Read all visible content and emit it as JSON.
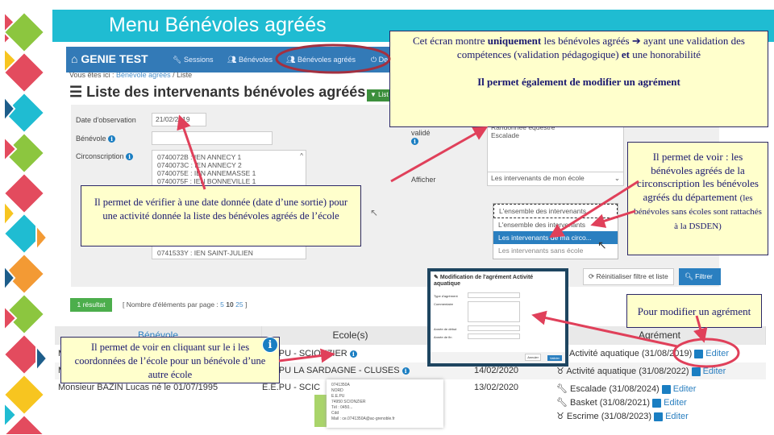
{
  "slide": {
    "title": "Menu Bénévoles agréés",
    "accent": "#1fbcd2"
  },
  "app": {
    "brand": "GENIE TEST",
    "nav": [
      {
        "label": "Sessions",
        "icon": "wrench-icon"
      },
      {
        "label": "Bénévoles",
        "icon": "users-icon"
      },
      {
        "label": "Bénévoles agréés",
        "icon": "users-icon"
      },
      {
        "label": "De",
        "icon": "power-icon"
      }
    ],
    "breadcrumb": {
      "prefix": "Vous êtes ici :",
      "item": "Bénévole agréés",
      "sep": "/",
      "current": "Liste"
    },
    "heading": "Liste des intervenants bénévoles agréés",
    "list_button": "List",
    "filters": {
      "date_label": "Date d'observation",
      "date_value": "21/02/2019",
      "benevole_label": "Bénévole",
      "benevole_value": "",
      "circ_label": "Circonscription",
      "circ_options": [
        "0740072B : IEN ANNECY 1",
        "0740073C : IEN ANNECY 2",
        "0740075E : IEN ANNEMASSE 1",
        "0740075F : IEN BONNEVILLE 1"
      ],
      "circ_last": "0741533Y : IEN SAINT-JULIEN",
      "valide_label": "validé",
      "activities": [
        "Randonnée équestre",
        "Escalade"
      ],
      "afficher_label": "Afficher",
      "afficher_value": "Les intervenants de mon école",
      "dropdown_selected": "L'ensemble des intervenants",
      "dropdown_options": [
        "L'ensemble des intervenants",
        "Les intervenants de ma circo...",
        "Les intervenants sans école"
      ],
      "dropdown_highlight": "#2a7fc0",
      "reset_button": "Réinitialiser filtre et liste",
      "filter_button": "Filtrer"
    },
    "results": {
      "count_label": "1 résultat",
      "per_page_prefix": "[ Nombre d'éléments par page :",
      "per_page_options": [
        "5",
        "10",
        "25"
      ],
      "per_page_suffix": "]"
    },
    "table": {
      "headers": [
        "Bénévole",
        "Ecole(s)",
        "",
        "Agrément"
      ],
      "rows": [
        {
          "benevole": "M",
          "ecole": "E.E.PU - SCIONZIER",
          "date": "",
          "agrements": [
            {
              "text": "Activité aquatique (31/08/2019)",
              "icon": "award-icon"
            }
          ]
        },
        {
          "benevole": "M",
          "ecole": "E.E.PU LA SARDAGNE - CLUSES",
          "date": "14/02/2020",
          "agrements": [
            {
              "text": "Activité aquatique (31/08/2022)",
              "icon": "award-icon"
            }
          ]
        },
        {
          "benevole": "Monsieur BAZIN Lucas né le 01/07/1995",
          "ecole": "E.E.PU - SCIC",
          "date": "13/02/2020",
          "agrements": [
            {
              "text": "Escalade (31/08/2024)",
              "icon": "wrench-icon"
            },
            {
              "text": "Basket (31/08/2021)",
              "icon": "wrench-icon"
            },
            {
              "text": "Escrime (31/08/2023)",
              "icon": "award-icon"
            }
          ]
        }
      ],
      "edit_label": "Editer"
    },
    "popover": [
      "0741350A",
      "NORD",
      "E.E.PU",
      "74950 SCIONZIER",
      "Tél : 0450...",
      "Cdd",
      "Mail : ce.0741350A@ac-grenoble.fr"
    ],
    "modal": {
      "title": "Modification de l'agrément Activité aquatique",
      "fields": [
        "Type d'agrément",
        "Commentaire",
        "Année de début",
        "Année de fin"
      ],
      "cancel": "Annuler",
      "submit": "Valider"
    }
  },
  "callouts": {
    "top": {
      "p1a": "Cet écran montre ",
      "p1b": "uniquement",
      "p1c": " les bénévoles agréés ➔ ayant une validation  des compétences (validation pédagogique) ",
      "p1d": "et",
      "p1e": " une honorabilité",
      "p2": "Il permet également de modifier un agrément"
    },
    "left": "Il permet de vérifier à une date donnée (date d’une sortie) pour une activité donnée la liste des bénévoles agréés de l’école",
    "right_a": "Il permet de voir : les bénévoles agréés de la circonscription les bénévoles agréés du département",
    "right_b": "(les bénévoles sans écoles sont rattachés à la DSDEN)",
    "edit": "Pour modifier un agrément",
    "info": "Il permet de voir en cliquant sur le  i les coordonnées de l’école pour un bénévole d’une autre école",
    "border": "#2b2766",
    "fill": "#ffffcc",
    "arrow": "#e0405a"
  }
}
